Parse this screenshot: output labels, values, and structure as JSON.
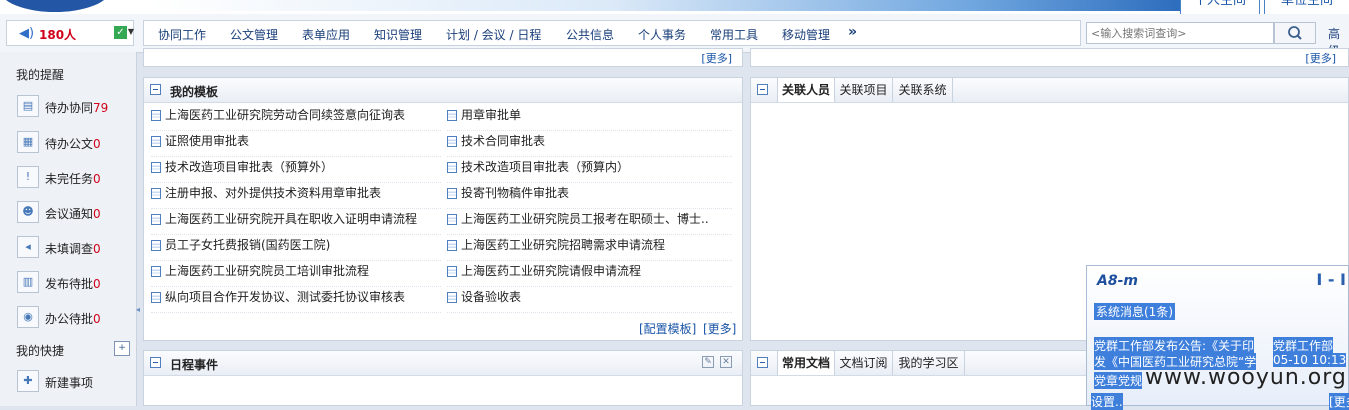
{
  "top": {
    "tab_personal": "个人空间",
    "tab_unit": "单位空间"
  },
  "user": {
    "online_count": "180人"
  },
  "nav": {
    "items": [
      "协同工作",
      "公文管理",
      "表单应用",
      "知识管理",
      "计划 / 会议 / 日程",
      "公共信息",
      "个人事务",
      "常用工具",
      "移动管理"
    ],
    "more": "»",
    "search_placeholder": "<输入搜索词查询>",
    "advanced": "高级"
  },
  "sidebar": {
    "reminders_title": "我的提醒",
    "items": [
      {
        "label": "待办协同",
        "count": "79"
      },
      {
        "label": "待办公文",
        "count": "0"
      },
      {
        "label": "未完任务",
        "count": "0"
      },
      {
        "label": "会议通知",
        "count": "0"
      },
      {
        "label": "未填调查",
        "count": "0"
      },
      {
        "label": "发布待批",
        "count": "0"
      },
      {
        "label": "办公待批",
        "count": "0"
      }
    ],
    "shortcuts_title": "我的快捷",
    "shortcut_items": [
      {
        "label": "新建事项"
      }
    ]
  },
  "upper": {
    "more_left": "[更多]",
    "more_right": "[更多]"
  },
  "templates": {
    "title": "我的模板",
    "items": [
      "上海医药工业研究院劳动合同续签意向征询表",
      "用章审批单",
      "证照使用审批表",
      "技术合同审批表",
      "技术改造项目审批表（预算外）",
      "技术改造项目审批表（预算内）",
      "注册申报、对外提供技术资料用章审批表",
      "投寄刊物稿件审批表",
      "上海医药工业研究院开具在职收入证明申请流程",
      "上海医药工业研究院员工报考在职硕士、博士..",
      "员工子女托费报销(国药医工院)",
      "上海医药工业研究院招聘需求申请流程",
      "上海医药工业研究院员工培训审批流程",
      "上海医药工业研究院请假申请流程",
      "纵向项目合作开发协议、测试委托协议审核表",
      "设备验收表"
    ],
    "config_link": "[配置模板]",
    "more_link": "[更多]"
  },
  "related": {
    "tabs": [
      "关联人员",
      "关联项目",
      "关联系统"
    ]
  },
  "schedule": {
    "title": "日程事件"
  },
  "docs": {
    "tabs": [
      "常用文档",
      "文档订阅",
      "我的学习区"
    ]
  },
  "popup": {
    "logo": "A8-m",
    "controls": "I - I",
    "title": "系统消息(1条)",
    "line1_left": "党群工作部发布公告:《关于印",
    "line1_right": "党群工作部",
    "line2_left": "发《中国医药工业研究总院“学",
    "line2_right": "05-10 10:13",
    "line3_left": "党章党规",
    "line4_left": "设置..",
    "line4_right": "[更多"
  },
  "watermark": "www.wooyun.org"
}
